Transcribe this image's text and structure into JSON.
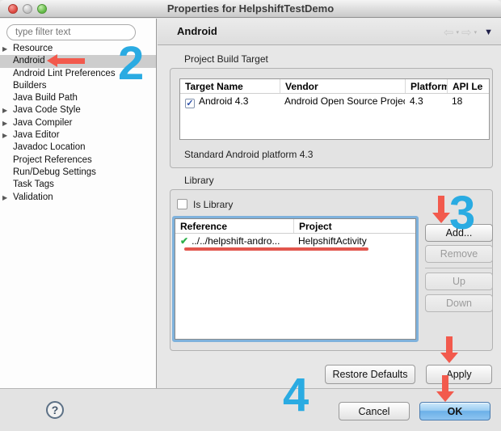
{
  "window": {
    "title": "Properties for HelpshiftTestDemo"
  },
  "header": {
    "title": "Android"
  },
  "sidebar": {
    "filter_placeholder": "type filter text",
    "items": [
      {
        "label": "Resource",
        "expandable": true,
        "selected": false
      },
      {
        "label": "Android",
        "expandable": false,
        "selected": true
      },
      {
        "label": "Android Lint Preferences",
        "expandable": false,
        "selected": false
      },
      {
        "label": "Builders",
        "expandable": false,
        "selected": false
      },
      {
        "label": "Java Build Path",
        "expandable": false,
        "selected": false
      },
      {
        "label": "Java Code Style",
        "expandable": true,
        "selected": false
      },
      {
        "label": "Java Compiler",
        "expandable": true,
        "selected": false
      },
      {
        "label": "Java Editor",
        "expandable": true,
        "selected": false
      },
      {
        "label": "Javadoc Location",
        "expandable": false,
        "selected": false
      },
      {
        "label": "Project References",
        "expandable": false,
        "selected": false
      },
      {
        "label": "Run/Debug Settings",
        "expandable": false,
        "selected": false
      },
      {
        "label": "Task Tags",
        "expandable": false,
        "selected": false
      },
      {
        "label": "Validation",
        "expandable": true,
        "selected": false
      }
    ]
  },
  "build_target": {
    "group_label": "Project Build Target",
    "columns": [
      "Target Name",
      "Vendor",
      "Platform",
      "API Le"
    ],
    "row": {
      "checked": true,
      "target_name": "Android 4.3",
      "vendor": "Android Open Source Project",
      "platform": "4.3",
      "api_level": "18"
    },
    "description": "Standard Android platform 4.3"
  },
  "library": {
    "group_label": "Library",
    "is_library_label": "Is Library",
    "is_library_checked": false,
    "columns": [
      "Reference",
      "Project"
    ],
    "row": {
      "reference": "../../helpshift-andro...",
      "project": "HelpshiftActivity"
    },
    "buttons": {
      "add": "Add...",
      "remove": "Remove",
      "up": "Up",
      "down": "Down"
    }
  },
  "actions": {
    "restore_defaults": "Restore Defaults",
    "apply": "Apply",
    "cancel": "Cancel",
    "ok": "OK"
  },
  "icons": {
    "expander": "▶",
    "checkbox_check": "✓",
    "green_check": "✔",
    "help": "?",
    "nav_back": "⇦",
    "nav_forward": "⇨",
    "small_dropdown": "▾",
    "view_menu": "▼"
  },
  "annotations": {
    "step2": "2",
    "step3": "3",
    "step4": "4",
    "accent_blue": "#2aabe2",
    "accent_red": "#f25a4d"
  }
}
